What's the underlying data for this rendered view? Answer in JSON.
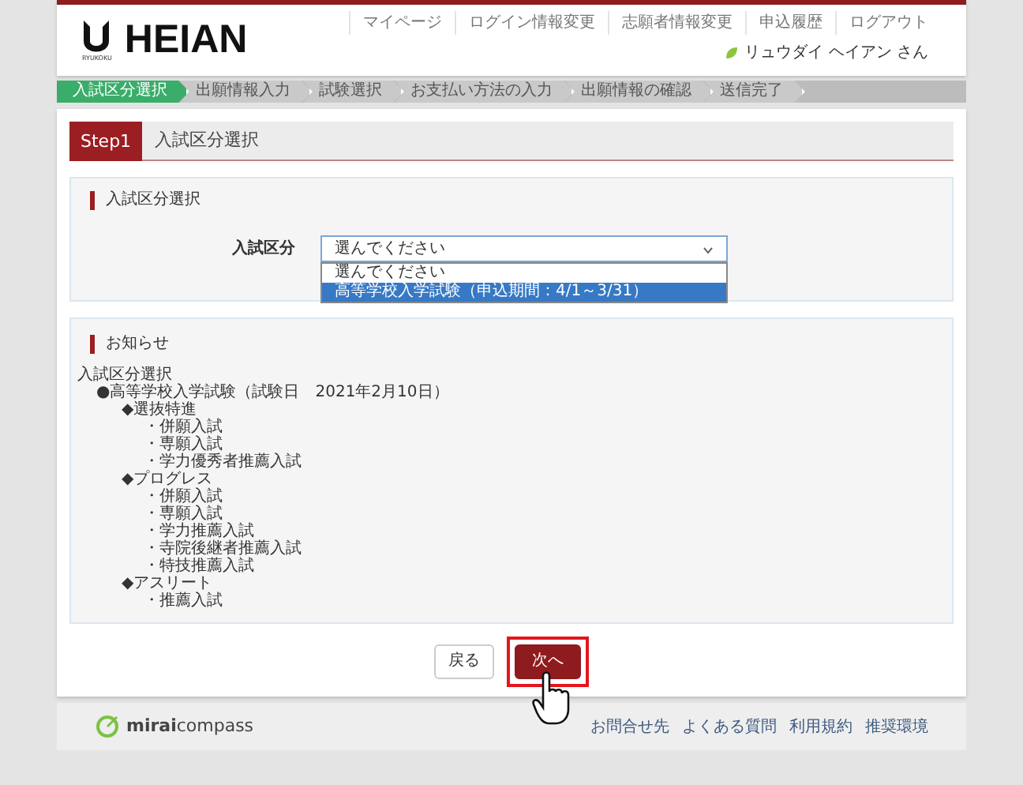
{
  "header": {
    "logo_text": "HEIAN",
    "logo_subtext": "RYUKOKU",
    "nav_links": [
      "マイページ",
      "ログイン情報変更",
      "志願者情報変更",
      "申込履歴",
      "ログアウト"
    ],
    "user_name": "リュウダイ ヘイアン さん"
  },
  "steps": [
    {
      "label": "入試区分選択",
      "selected": true
    },
    {
      "label": "出願情報入力",
      "selected": false
    },
    {
      "label": "試験選択",
      "selected": false
    },
    {
      "label": "お支払い方法の入力",
      "selected": false
    },
    {
      "label": "出願情報の確認",
      "selected": false
    },
    {
      "label": "送信完了",
      "selected": false
    }
  ],
  "step_header": {
    "badge": "Step1",
    "title": "入試区分選択"
  },
  "selection_section": {
    "title": "入試区分選択",
    "label": "入試区分",
    "select": {
      "value": "選んでください",
      "expanded": true,
      "options": [
        {
          "label": "選んでください",
          "highlighted": false
        },
        {
          "label": "高等学校入学試験（申込期間：4/1～3/31）",
          "highlighted": true
        }
      ]
    }
  },
  "notice": {
    "title": "お知らせ",
    "items": [
      {
        "text": "入試区分選択",
        "children": [
          {
            "text": "●高等学校入学試験（試験日　2021年2月10日）",
            "children": [
              {
                "text": "◆選抜特進",
                "children": [
                  {
                    "text": "・併願入試"
                  },
                  {
                    "text": "・専願入試"
                  },
                  {
                    "text": "・学力優秀者推薦入試"
                  }
                ]
              },
              {
                "text": "◆プログレス",
                "children": [
                  {
                    "text": "・併願入試"
                  },
                  {
                    "text": "・専願入試"
                  },
                  {
                    "text": "・学力推薦入試"
                  },
                  {
                    "text": "・寺院後継者推薦入試"
                  },
                  {
                    "text": "・特技推薦入試"
                  }
                ]
              },
              {
                "text": "◆アスリート",
                "children": [
                  {
                    "text": "・推薦入試"
                  }
                ]
              }
            ]
          }
        ]
      }
    ]
  },
  "buttons": [
    {
      "label": "戻る",
      "kind": "back",
      "highlighted": false
    },
    {
      "label": "次へ",
      "kind": "next",
      "highlighted": true
    }
  ],
  "footer": {
    "logo": "**mirai**compass",
    "links": [
      "お問合せ先",
      "よくある質問",
      "利用規約",
      "推奨環境"
    ]
  }
}
